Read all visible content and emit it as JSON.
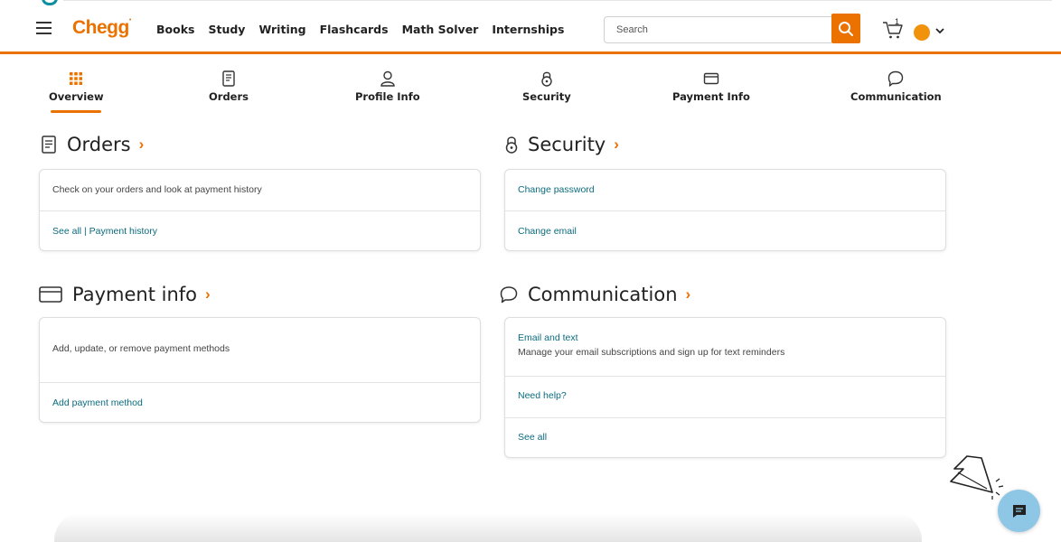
{
  "header": {
    "logo": "Chegg",
    "nav": [
      "Books",
      "Study",
      "Writing",
      "Flashcards",
      "Math Solver",
      "Internships"
    ],
    "search_placeholder": "Search",
    "cart_count": "1",
    "icons": {
      "menu": "hamburger-icon",
      "search": "search-icon",
      "cart": "cart-icon",
      "account": "avatar",
      "dropdown": "chevron-down-icon"
    }
  },
  "tabs": [
    {
      "label": "Overview",
      "icon": "grid-icon",
      "active": true
    },
    {
      "label": "Orders",
      "icon": "receipt-icon"
    },
    {
      "label": "Profile Info",
      "icon": "user-icon"
    },
    {
      "label": "Security",
      "icon": "lock-icon"
    },
    {
      "label": "Payment Info",
      "icon": "credit-card-icon"
    },
    {
      "label": "Communication",
      "icon": "chat-bubble-icon"
    }
  ],
  "orders": {
    "title": "Orders",
    "description": "Check on your orders and look at payment history",
    "link_see_all": "See all",
    "link_separator": " | ",
    "link_payment_history": "Payment history"
  },
  "security": {
    "title": "Security",
    "change_password": "Change password",
    "change_email": "Change email"
  },
  "payment": {
    "title": "Payment info",
    "description": "Add, update, or remove payment methods",
    "add_link": "Add payment method"
  },
  "communication": {
    "title": "Communication",
    "email_text_link": "Email and text",
    "email_text_desc": "Manage your email subscriptions and sign up for text reminders",
    "need_help": "Need help?",
    "see_all": "See all"
  },
  "colors": {
    "brand": "#eb7100",
    "link": "#0b6b7e",
    "chat_button": "#8ec7e6"
  }
}
